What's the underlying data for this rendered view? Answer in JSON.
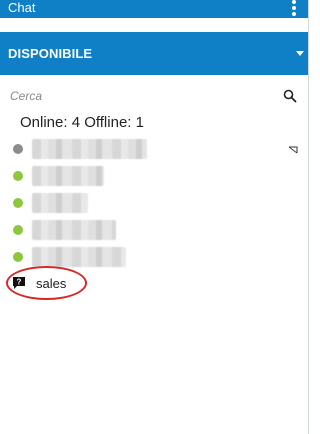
{
  "header": {
    "title": "Chat",
    "menu_icon": "more-vertical-icon"
  },
  "status": {
    "label": "DISPONIBILE",
    "caret_icon": "caret-down-icon",
    "color": "#0f7fc6"
  },
  "search": {
    "placeholder": "Cerca",
    "value": "",
    "icon": "search-icon"
  },
  "summary": {
    "text": "Online: 4 Offline: 1"
  },
  "contacts": [
    {
      "status": "offline",
      "dot_color": "#8c8c8c"
    },
    {
      "status": "online",
      "dot_color": "#8dc63f"
    },
    {
      "status": "online",
      "dot_color": "#8dc63f"
    },
    {
      "status": "online",
      "dot_color": "#8dc63f"
    },
    {
      "status": "online",
      "dot_color": "#8dc63f"
    }
  ],
  "queue": {
    "label": "sales",
    "icon": "question-chat-icon",
    "highlight_color": "#d62828"
  }
}
